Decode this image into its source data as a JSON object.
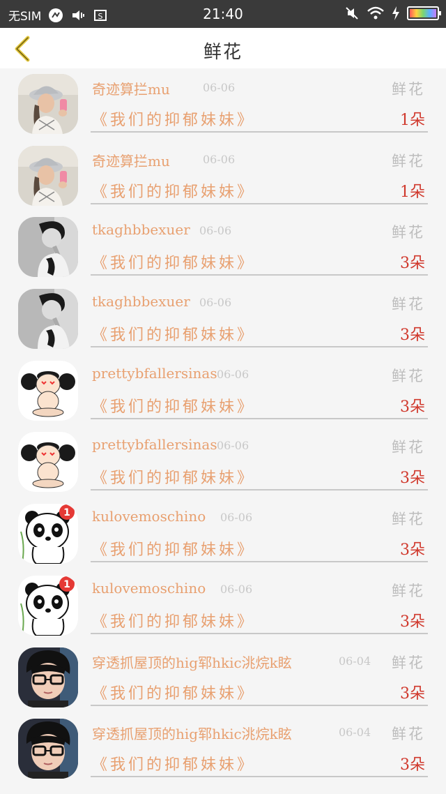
{
  "status_bar": {
    "sim": "无SIM",
    "time": "21:40",
    "icons": [
      "nfc-icon",
      "vibrate-icon",
      "screenshot-icon",
      "mute-icon",
      "wifi-icon",
      "charging-icon",
      "battery-icon"
    ]
  },
  "header": {
    "back_icon": "chevron-left-icon",
    "title": "鲜花",
    "back_color": "#e3c840"
  },
  "colors": {
    "name": "#e8a070",
    "count": "#d0382c",
    "muted": "#c8c8c8"
  },
  "items": [
    {
      "name": "奇迹算拦mu",
      "date": "06-06",
      "gift": "鲜花",
      "song": "《我们的抑郁妹妹》",
      "count": "1朵",
      "avatar": "girl-hat-avatar"
    },
    {
      "name": "奇迹算拦mu",
      "date": "06-06",
      "gift": "鲜花",
      "song": "《我们的抑郁妹妹》",
      "count": "1朵",
      "avatar": "girl-hat-avatar"
    },
    {
      "name": "tkaghbbexuer",
      "date": "06-06",
      "gift": "鲜花",
      "song": "《我们的抑郁妹妹》",
      "count": "3朵",
      "avatar": "bw-profile-avatar"
    },
    {
      "name": "tkaghbbexuer",
      "date": "06-06",
      "gift": "鲜花",
      "song": "《我们的抑郁妹妹》",
      "count": "3朵",
      "avatar": "bw-profile-avatar"
    },
    {
      "name": "prettybfallersinas",
      "date": "06-06",
      "gift": "鲜花",
      "song": "《我们的抑郁妹妹》",
      "count": "3朵",
      "avatar": "cartoon-girl-avatar"
    },
    {
      "name": "prettybfallersinas",
      "date": "06-06",
      "gift": "鲜花",
      "song": "《我们的抑郁妹妹》",
      "count": "3朵",
      "avatar": "cartoon-girl-avatar"
    },
    {
      "name": "kulovemoschino",
      "date": "06-06",
      "gift": "鲜花",
      "song": "《我们的抑郁妹妹》",
      "count": "3朵",
      "avatar": "panda-avatar"
    },
    {
      "name": "kulovemoschino",
      "date": "06-06",
      "gift": "鲜花",
      "song": "《我们的抑郁妹妹》",
      "count": "3朵",
      "avatar": "panda-avatar"
    },
    {
      "name": "穿透抓屋顶的hig郓hkic洮烷k眩",
      "date": "06-04",
      "gift": "鲜花",
      "song": "《我们的抑郁妹妹》",
      "count": "3朵",
      "avatar": "boy-glasses-avatar"
    },
    {
      "name": "穿透抓屋顶的hig郓hkic洮烷k眩",
      "date": "06-04",
      "gift": "鲜花",
      "song": "《我们的抑郁妹妹》",
      "count": "3朵",
      "avatar": "boy-glasses-avatar"
    }
  ]
}
